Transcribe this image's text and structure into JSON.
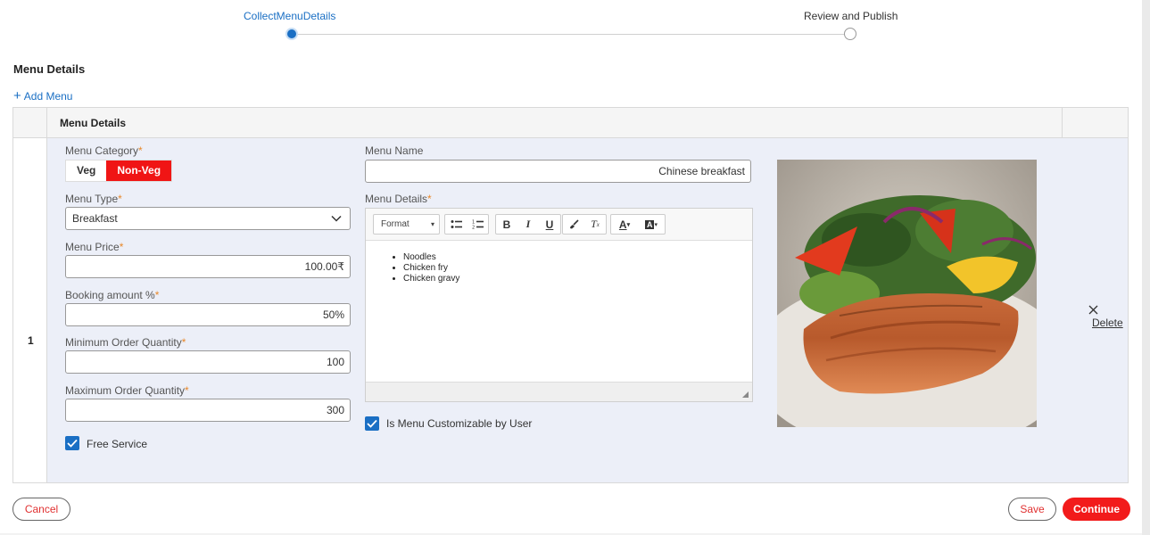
{
  "stepper": {
    "steps": [
      {
        "label": "CollectMenuDetails",
        "state": "active"
      },
      {
        "label": "Review and Publish",
        "state": "pending"
      }
    ],
    "accent": "#1a6fc4"
  },
  "section": {
    "title": "Menu Details",
    "add_label": "Add Menu"
  },
  "grid": {
    "header": "Menu Details",
    "row_number": "1",
    "row": {
      "category": {
        "label": "Menu Category",
        "options": [
          "Veg",
          "Non-Veg"
        ],
        "selected": "Non-Veg"
      },
      "menu_type": {
        "label": "Menu Type",
        "value": "Breakfast"
      },
      "price": {
        "label": "Menu Price",
        "value": "100.00₹"
      },
      "booking": {
        "label": "Booking amount %",
        "value": "50%"
      },
      "min_qty": {
        "label": "Minimum Order Quantity",
        "value": "100"
      },
      "max_qty": {
        "label": "Maximum Order Quantity",
        "value": "300"
      },
      "free_service": {
        "label": "Free Service",
        "checked": true
      },
      "menu_name": {
        "label": "Menu Name",
        "value": "Chinese breakfast"
      },
      "menu_details": {
        "label": "Menu Details",
        "format_label": "Format",
        "items": [
          "Noodles",
          "Chicken fry",
          "Chicken gravy"
        ]
      },
      "customizable": {
        "label": "Is Menu Customizable by User",
        "checked": true
      },
      "delete_label": "Delete"
    },
    "required_mark": "*"
  },
  "footer": {
    "cancel_label": "Cancel",
    "save_label": "Save",
    "continue_label": "Continue"
  },
  "colors": {
    "brand_red": "#f21b1b",
    "required": "#e8882a",
    "row_bg": "#eceff8"
  }
}
